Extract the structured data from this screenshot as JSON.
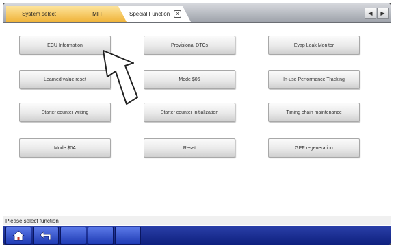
{
  "tabs": [
    {
      "label": "System select"
    },
    {
      "label": "MFI"
    },
    {
      "label": "Special Function",
      "close_label": "x"
    }
  ],
  "scroll": {
    "left_glyph": "◀",
    "right_glyph": "▶"
  },
  "buttons": [
    "ECU Information",
    "Provisional DTCs",
    "Evap Leak Monitor",
    "Learned value reset",
    "Mode $06",
    "In-use Performance Tracking",
    "Starter counter writing",
    "Starter counter initialization",
    "Timing chain maintenance",
    "Mode $0A",
    "Reset",
    "GPF regeneration"
  ],
  "status_text": "Please select function",
  "bottom_bar": {
    "icons": [
      "home-icon",
      "back-arrow-icon"
    ],
    "empty_slots": 3
  },
  "colors": {
    "active_tab": "#f0b43a",
    "bottom_bar": "#0e1f7d",
    "bottom_button": "#1f3bb5"
  }
}
